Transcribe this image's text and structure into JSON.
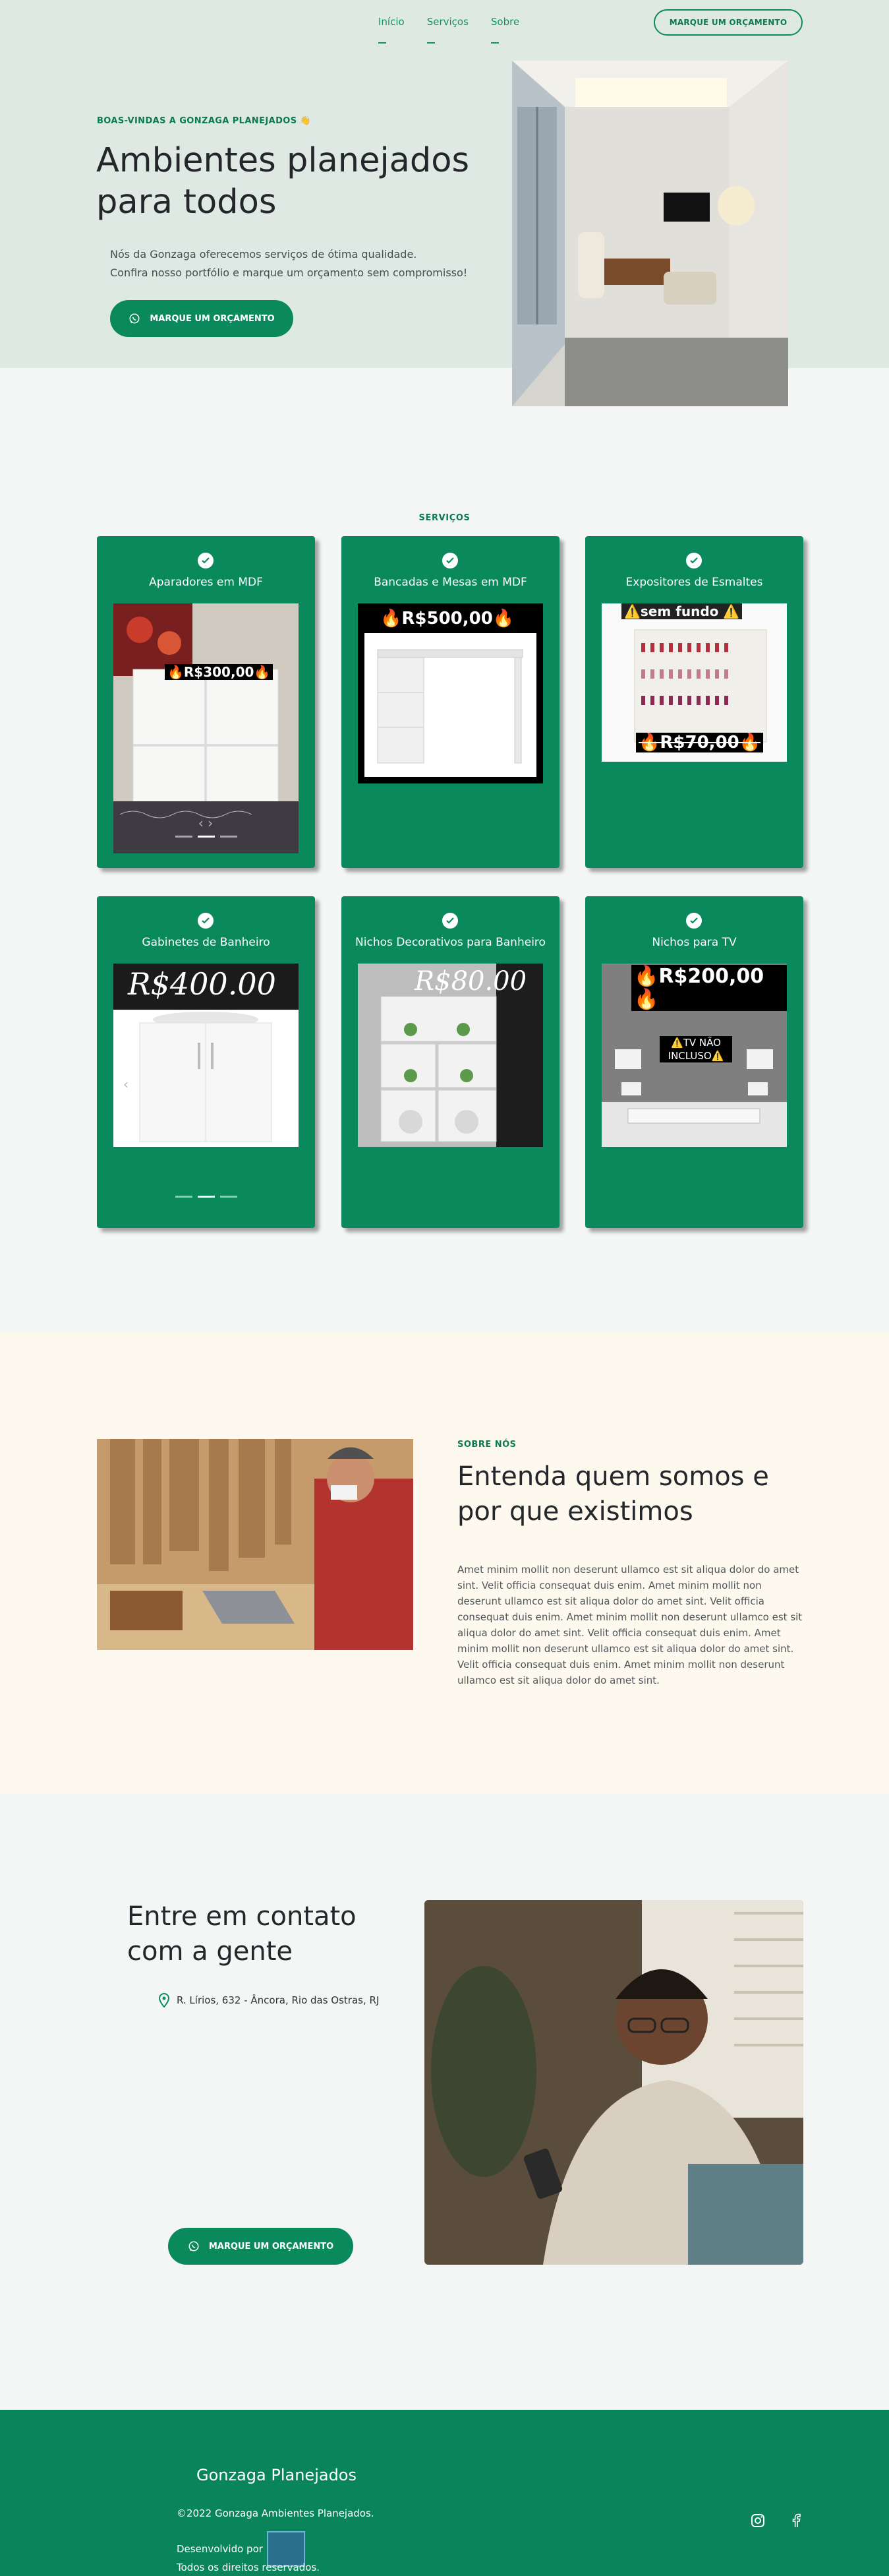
{
  "nav": {
    "items": [
      {
        "label": "Início"
      },
      {
        "label": "Serviços"
      },
      {
        "label": "Sobre"
      }
    ],
    "cta_label": "MARQUE UM ORÇAMENTO"
  },
  "hero": {
    "kicker": "BOAS-VINDAS A GONZAGA PLANEJADOS 👋",
    "title": "Ambientes planejados para todos",
    "desc_line1": "Nós da Gonzaga oferecemos serviços de ótima qualidade.",
    "desc_line2": "Confira nosso portfólio e marque um orçamento sem compromisso!",
    "cta_label": "MARQUE UM ORÇAMENTO"
  },
  "services": {
    "kicker": "SERVIÇOS",
    "cards": [
      {
        "title": "Aparadores em MDF",
        "price": "🔥R$300,00🔥"
      },
      {
        "title": "Bancadas e Mesas em MDF",
        "price": "🔥R$500,00🔥"
      },
      {
        "title": "Expositores de Esmaltes",
        "badge": "⚠️sem fundo ⚠️",
        "price": "🔥R$70,00🔥"
      },
      {
        "title": "Gabinetes de Banheiro",
        "price": "R$400.00"
      },
      {
        "title": "Nichos Decorativos para Banheiro",
        "price": "R$80.00"
      },
      {
        "title": "Nichos para TV",
        "price": "🔥R$200,00🔥",
        "badge": "⚠️TV NÃO INCLUSO⚠️"
      }
    ]
  },
  "about": {
    "kicker": "SOBRE NÓS",
    "title": "Entenda quem somos e por que existimos",
    "text": "Amet minim mollit non deserunt ullamco est sit aliqua dolor do amet sint. Velit officia consequat duis enim. Amet minim mollit non deserunt ullamco est sit aliqua dolor do amet sint. Velit officia consequat duis enim. Amet minim mollit non deserunt ullamco est sit aliqua dolor do amet sint. Velit officia consequat duis enim. Amet minim mollit non deserunt ullamco est sit aliqua dolor do amet sint. Velit officia consequat duis enim. Amet minim mollit non deserunt ullamco est sit aliqua dolor do amet sint."
  },
  "contact": {
    "title": "Entre em contato com a gente",
    "address": "R. Lírios, 632 - Âncora, Rio das Ostras, RJ",
    "cta_label": "MARQUE UM ORÇAMENTO"
  },
  "footer": {
    "brand": "Gonzaga Planejados",
    "copyright": "©2022 Gonzaga Ambientes Planejados.",
    "developed_by": "Desenvolvido por",
    "rights": "Todos os direitos reservados."
  },
  "colors": {
    "brand_green": "#0a8a5c",
    "hero_bg": "#dfe9e3",
    "about_bg": "#fdf9ee"
  },
  "icons": [
    "whatsapp-icon",
    "check-icon",
    "location-pin-icon",
    "instagram-icon",
    "facebook-icon"
  ]
}
